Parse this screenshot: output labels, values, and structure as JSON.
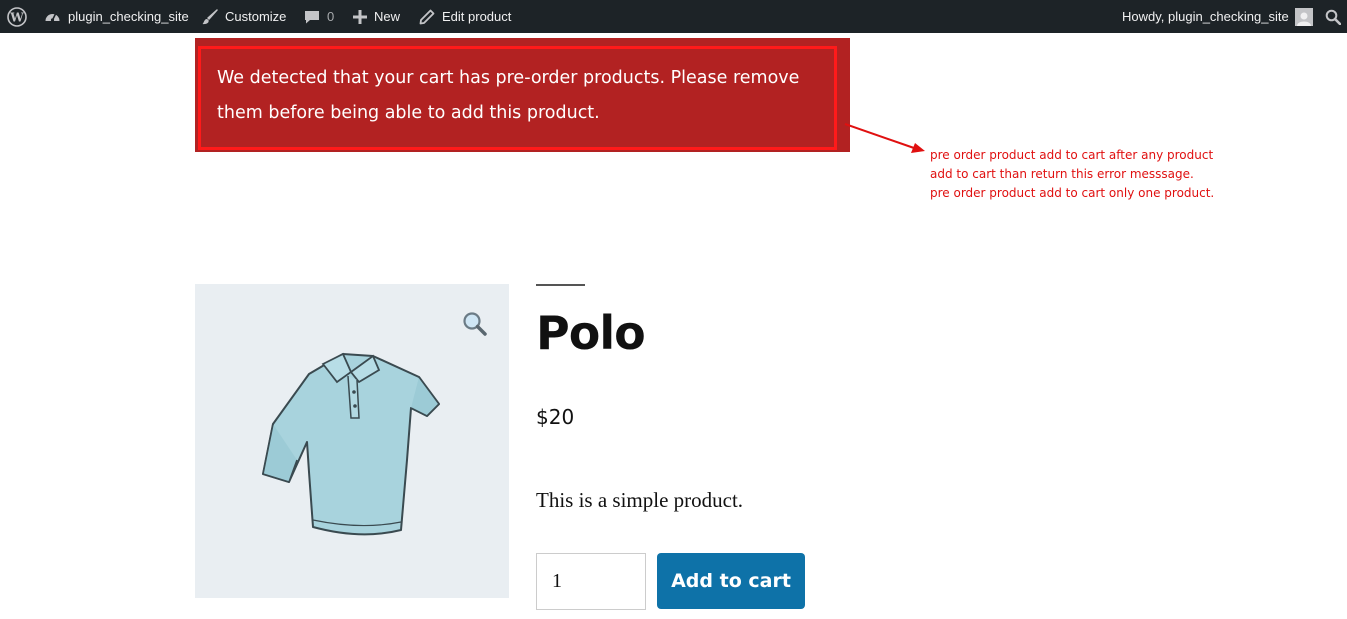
{
  "admin_bar": {
    "site_name": "plugin_checking_site",
    "customize": "Customize",
    "comments_count": "0",
    "new": "New",
    "edit_product": "Edit product",
    "howdy": "Howdy, plugin_checking_site"
  },
  "notice": {
    "message": "We detected that your cart has pre-order products. Please remove them before being able to add this product."
  },
  "annotation": {
    "lines": [
      "pre order product add to cart after any product",
      "add to cart than return this error messsage.",
      "pre order product add to cart only one product."
    ],
    "color": "#e01010"
  },
  "product": {
    "title": "Polo",
    "price": "$20",
    "description": "This is a simple product.",
    "quantity": "1",
    "add_to_cart": "Add to cart"
  },
  "colors": {
    "admin_bar_bg": "#1d2327",
    "notice_bg": "#b22222",
    "button_bg": "#0e72a8"
  }
}
